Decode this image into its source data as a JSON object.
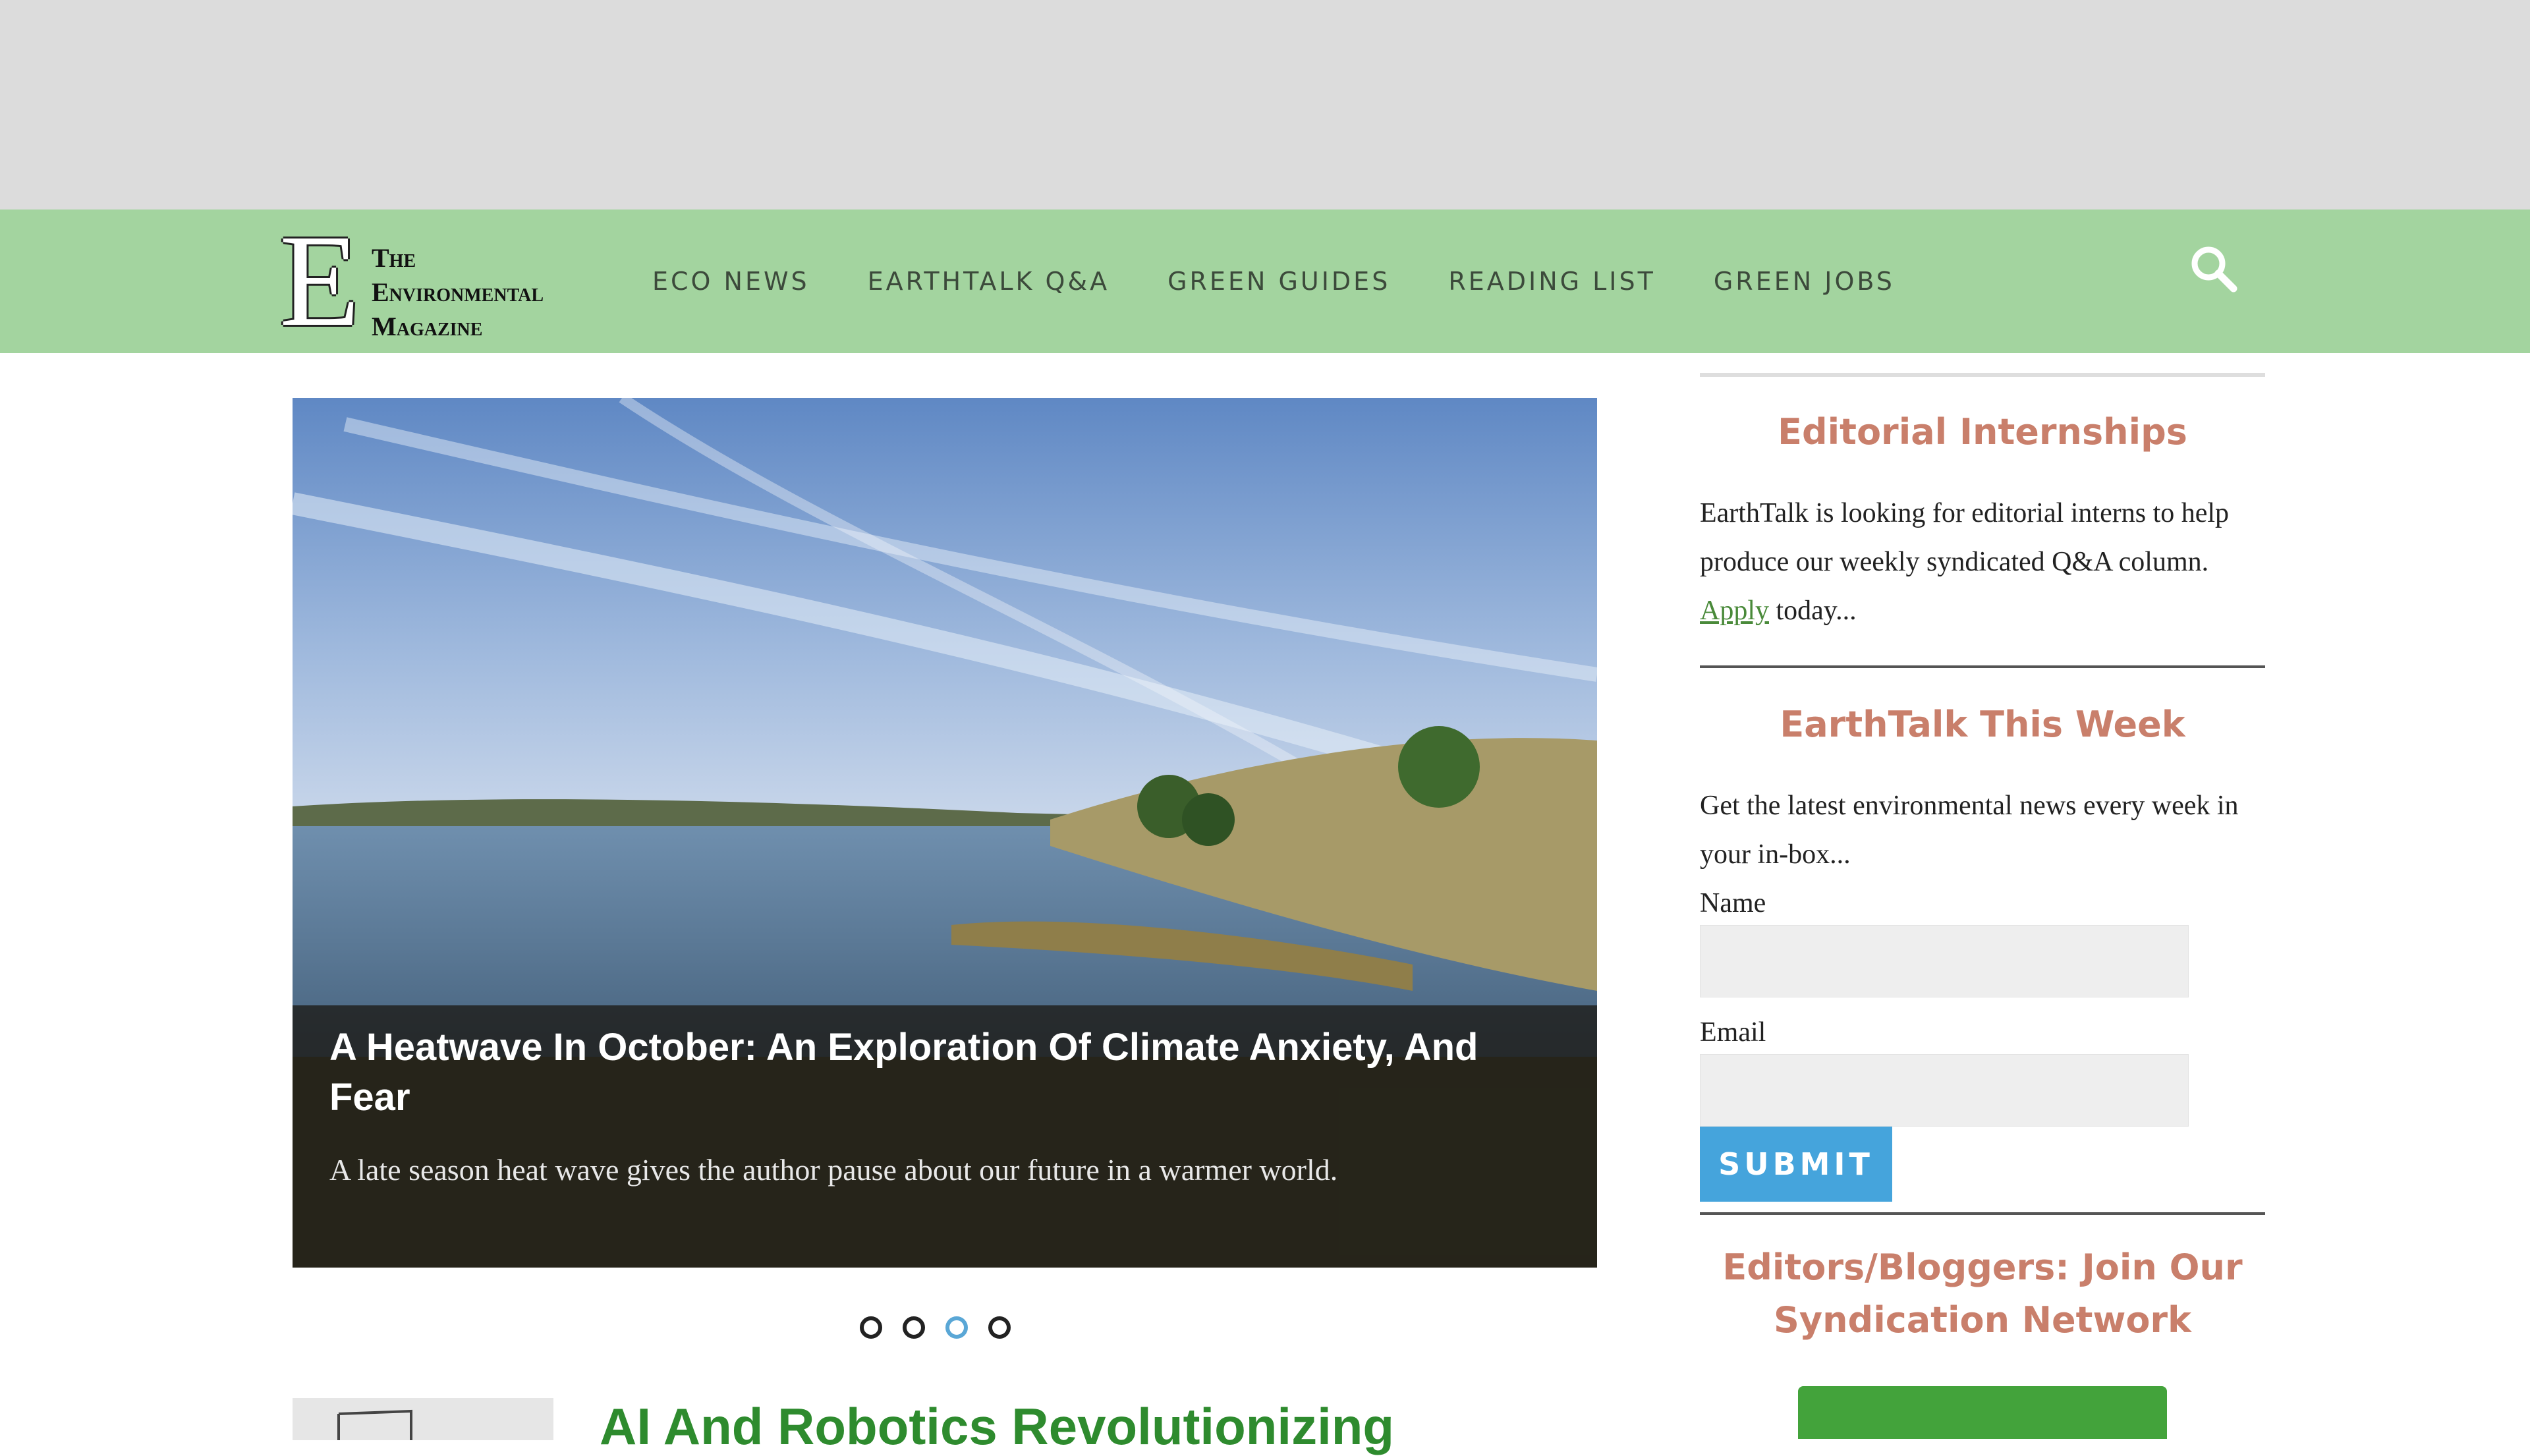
{
  "nav": {
    "logo": {
      "letter": "E",
      "line1": "The",
      "line2": "Environmental",
      "line3": "Magazine"
    },
    "links": [
      "ECO NEWS",
      "EARTHTALK Q&A",
      "GREEN GUIDES",
      "READING LIST",
      "GREEN JOBS"
    ]
  },
  "slider": {
    "title": "A Heatwave In October: An Exploration Of Climate Anxiety, And Fear",
    "excerpt": "A late season heat wave gives the author pause about our future in a warmer world."
  },
  "next_article": {
    "title": "AI And Robotics Revolutionizing"
  },
  "sidebar": {
    "internships": {
      "title": "Editorial Internships",
      "text_before": "EarthTalk is looking for editorial interns to help produce our weekly syndicated Q&A column. ",
      "link": "Apply",
      "text_after": " today..."
    },
    "newsletter": {
      "title": "EarthTalk This Week",
      "text": "Get the latest environmental news every week in your in-box...",
      "name_label": "Name",
      "email_label": "Email",
      "submit_label": "SUBMIT"
    },
    "syndication": {
      "title": "Editors/Bloggers: Join Our Syndication Network"
    }
  },
  "colors": {
    "nav_bg": "#a3d49f",
    "accent_title": "#c97f6b",
    "submit_bg": "#45a4dc",
    "link_green": "#2e8b2e"
  }
}
